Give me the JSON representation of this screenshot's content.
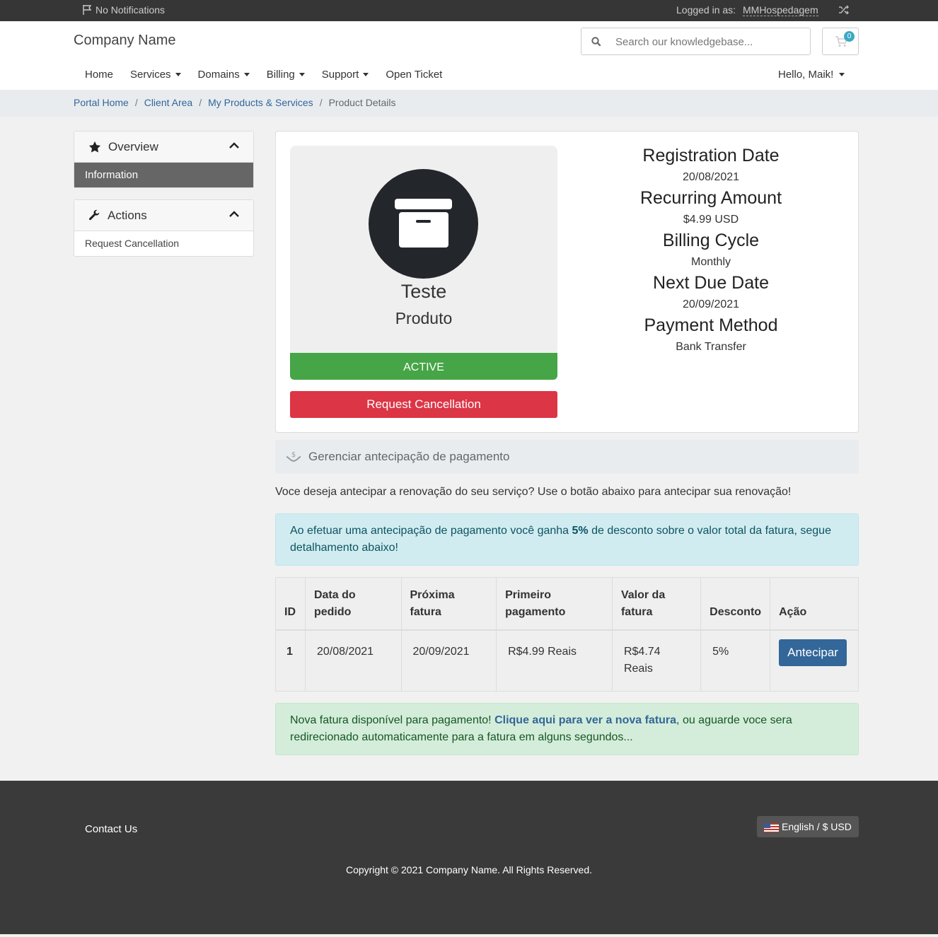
{
  "topbar": {
    "notifications": "No Notifications",
    "logged_in_label": "Logged in as:",
    "username": "MMHospedagem"
  },
  "header": {
    "brand": "Company Name",
    "search_placeholder": "Search our knowledgebase...",
    "cart_count": "0"
  },
  "nav": {
    "home": "Home",
    "services": "Services",
    "domains": "Domains",
    "billing": "Billing",
    "support": "Support",
    "open_ticket": "Open Ticket",
    "hello": "Hello, Maik!"
  },
  "breadcrumb": [
    "Portal Home",
    "Client Area",
    "My Products & Services",
    "Product Details"
  ],
  "sidebar": {
    "overview_title": "Overview",
    "overview_item": "Information",
    "actions_title": "Actions",
    "actions_item": "Request Cancellation"
  },
  "product": {
    "name": "Teste",
    "group": "Produto",
    "status": "ACTIVE",
    "cancel_button": "Request Cancellation"
  },
  "details": {
    "registration_label": "Registration Date",
    "registration_value": "20/08/2021",
    "recurring_label": "Recurring Amount",
    "recurring_value": "$4.99 USD",
    "cycle_label": "Billing Cycle",
    "cycle_value": "Monthly",
    "next_due_label": "Next Due Date",
    "next_due_value": "20/09/2021",
    "payment_label": "Payment Method",
    "payment_value": "Bank Transfer"
  },
  "manage_bar": "Gerenciar antecipação de pagamento",
  "intro_text": "Voce deseja antecipar a renovação do seu serviço? Use o botão abaixo para antecipar sua renovação!",
  "info_alert": {
    "before": "Ao efetuar uma antecipação de pagamento você ganha ",
    "highlight": "5%",
    "after": " de desconto sobre o valor total da fatura, segue detalhamento abaixo!"
  },
  "table": {
    "headers": [
      "ID",
      "Data do pedido",
      "Próxima fatura",
      "Primeiro pagamento",
      "Valor da fatura",
      "Desconto",
      "Ação"
    ],
    "row": {
      "id": "1",
      "order_date": "20/08/2021",
      "next_invoice": "20/09/2021",
      "first_payment": "R$4.99 Reais",
      "invoice_value": "R$4.74 Reais",
      "discount": "5%",
      "action": "Antecipar"
    }
  },
  "success_alert": {
    "before": "Nova fatura disponível para pagamento! ",
    "link": "Clique aqui para ver a nova fatura",
    "after": ", ou aguarde voce sera redirecionado automaticamente para a fatura em alguns segundos..."
  },
  "footer": {
    "contact": "Contact Us",
    "language": "English / $ USD",
    "copyright": "Copyright © 2021 Company Name. All Rights Reserved."
  }
}
